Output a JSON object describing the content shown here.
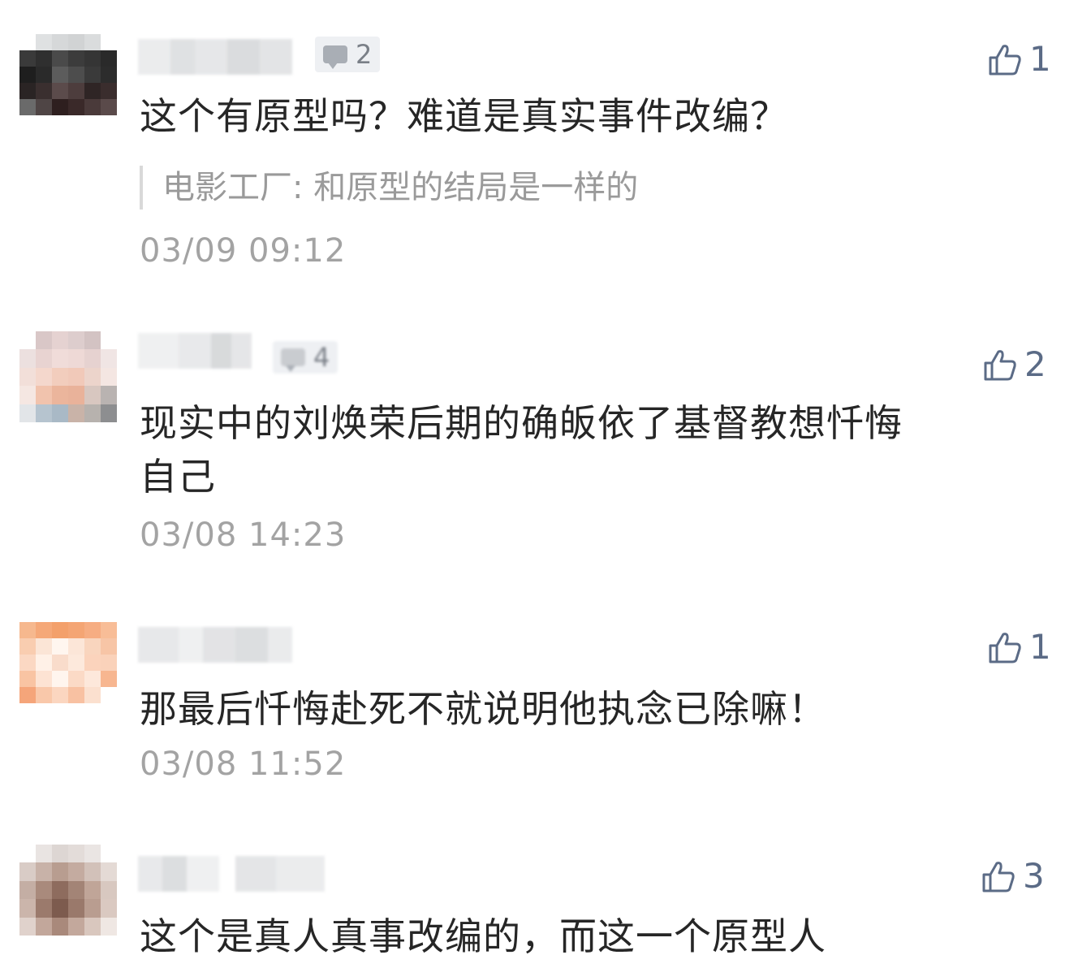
{
  "comments": [
    {
      "reply_count": "2",
      "likes": "1",
      "text": "这个有原型吗？难道是真实事件改编？",
      "quote": "电影工厂: 和原型的结局是一样的",
      "time": "03/09 09:12"
    },
    {
      "reply_count": "4",
      "likes": "2",
      "text": "现实中的刘焕荣后期的确皈依了基督教想忏悔自己",
      "time": "03/08 14:23"
    },
    {
      "likes": "1",
      "text": "那最后忏悔赴死不就说明他执念已除嘛！",
      "time": "03/08 11:52"
    },
    {
      "likes": "3",
      "text": "这个是真人真事改编的，而这一个原型人"
    }
  ],
  "icons": {
    "like": "thumbs-up-icon",
    "reply": "comment-bubble-icon"
  },
  "colors": {
    "like": "#5b6b86",
    "time": "#a3a3a3",
    "quote": "#9a9a9a"
  }
}
